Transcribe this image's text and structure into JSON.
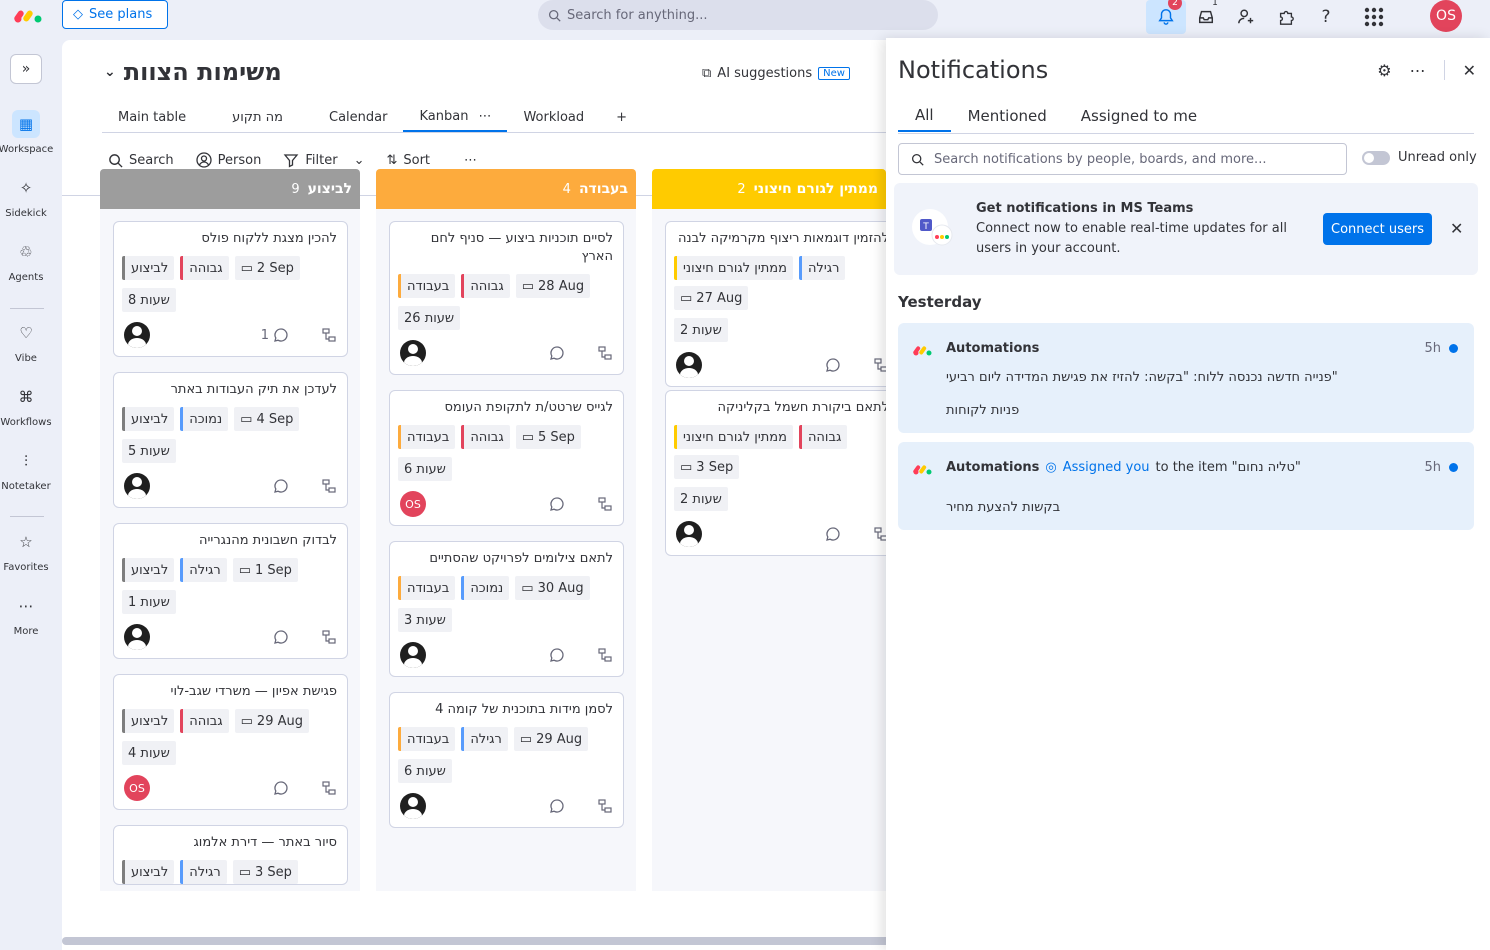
{
  "topbar": {
    "see_plans": "See plans",
    "search_placeholder": "Search for anything...",
    "notif_count": "2",
    "inbox_count": "1",
    "user_initials": "OS"
  },
  "sidebar": {
    "items": [
      {
        "label": "Workspace",
        "icon": "grid-icon"
      },
      {
        "label": "Sidekick",
        "icon": "sparkle-icon"
      },
      {
        "label": "Agents",
        "icon": "agent-icon"
      },
      {
        "label": "Vibe",
        "icon": "heart-icon"
      },
      {
        "label": "Workflows",
        "icon": "workflow-icon"
      },
      {
        "label": "Notetaker",
        "icon": "waveform-icon"
      },
      {
        "label": "Favorites",
        "icon": "star-icon"
      },
      {
        "label": "More",
        "icon": "more-icon"
      }
    ]
  },
  "board": {
    "title": "משימות הצוות",
    "ai_suggestions": "AI suggestions",
    "new_badge": "New",
    "views": [
      "Main table",
      "מה תקוע",
      "Calendar",
      "Kanban",
      "Workload"
    ],
    "add_view": "+",
    "toolbar": {
      "search": "Search",
      "person": "Person",
      "filter": "Filter",
      "sort": "Sort"
    }
  },
  "columns": [
    {
      "title": "לביצוע",
      "count": "9",
      "color": "#9d9d9d",
      "cards": [
        {
          "title": "להכין מצגת ללקוח פולס",
          "status": "לביצוע",
          "priority": "גבוהה",
          "date": "2 Sep",
          "hours": "8 שעות",
          "comments": "1",
          "owner": "person"
        },
        {
          "title": "לעדכן את תיק העבודות באתר",
          "status": "לביצוע",
          "priority": "נמוכה",
          "date": "4 Sep",
          "hours": "5 שעות",
          "comments": "",
          "owner": "person"
        },
        {
          "title": "לבדוק חשבונית מהנגרייה",
          "status": "לביצוע",
          "priority": "רגילה",
          "date": "1 Sep",
          "hours": "1 שעות",
          "comments": "",
          "owner": "person"
        },
        {
          "title": "פגישת אפיון — משרדי שגב-לוי",
          "status": "לביצוע",
          "priority": "גבוהה",
          "date": "29 Aug",
          "hours": "4 שעות",
          "comments": "",
          "owner": "os"
        },
        {
          "title": "סיור באתר — דירת אלמוג",
          "status": "לביצוע",
          "priority": "רגילה",
          "date": "3 Sep",
          "hours": "",
          "comments": "",
          "owner": ""
        }
      ]
    },
    {
      "title": "בעבודה",
      "count": "4",
      "color": "#fdab3d",
      "cards": [
        {
          "title": "לסיים תוכניות ביצוע — סניף לחם הארץ",
          "status": "בעבודה",
          "priority": "גבוהה",
          "date": "28 Aug",
          "hours": "26 שעות",
          "comments": "",
          "owner": "person"
        },
        {
          "title": "לגייס שרטט/ת לתקופת העומס",
          "status": "בעבודה",
          "priority": "גבוהה",
          "date": "5 Sep",
          "hours": "6 שעות",
          "comments": "",
          "owner": "os"
        },
        {
          "title": "לתאם צילומים לפרויקט שהסתיים",
          "status": "בעבודה",
          "priority": "נמוכה",
          "date": "30 Aug",
          "hours": "3 שעות",
          "comments": "",
          "owner": "person"
        },
        {
          "title": "לסמן מידות בתוכנית של קומה 4",
          "status": "בעבודה",
          "priority": "רגילה",
          "date": "29 Aug",
          "hours": "6 שעות",
          "comments": "",
          "owner": "person"
        }
      ]
    },
    {
      "title": "ממתין לגורם חיצוני",
      "count": "2",
      "color": "#ffcb00",
      "cards": [
        {
          "title": "להזמין דוגמאות ריצוף מקרמיקה לבנה",
          "status": "ממתין לגורם חיצוני",
          "priority": "רגילה",
          "date": "27 Aug",
          "hours": "2 שעות",
          "comments": "",
          "owner": "person"
        },
        {
          "title": "לתאם ביקורת חשמל בקליניקה",
          "status": "ממתין לגורם חיצוני",
          "priority": "גבוהה",
          "date": "3 Sep",
          "hours": "2 שעות",
          "comments": "",
          "owner": "person"
        }
      ]
    }
  ],
  "priority_colors": {
    "גבוהה": "#e2445c",
    "נמוכה": "#579bfc",
    "רגילה": "#579bfc"
  },
  "status_colors": {
    "לביצוע": "#7e7e7e",
    "בעבודה": "#fdab3d",
    "ממתין לגורם חיצוני": "#ffcb00"
  },
  "notifications": {
    "title": "Notifications",
    "tabs": [
      "All",
      "Mentioned",
      "Assigned to me"
    ],
    "search_placeholder": "Search notifications by people, boards, and more...",
    "unread_only": "Unread only",
    "teams": {
      "title": "Get notifications in MS Teams",
      "body": "Connect now to enable real-time updates for all users in your account.",
      "button": "Connect users"
    },
    "section": "Yesterday",
    "items": [
      {
        "sender": "Automations",
        "time": "5h",
        "message": "\"פנייה חדשה נכנסה ללוח: \"בקשה: להזיז את פגישת המדידה ליום רביעי",
        "board": "פניות לקוחות"
      },
      {
        "sender": "Automations",
        "assigned": "Assigned you",
        "suffix": "to the item \"טליה נחום\"",
        "time": "5h",
        "board": "בקשות להצעת מחיר"
      }
    ]
  }
}
